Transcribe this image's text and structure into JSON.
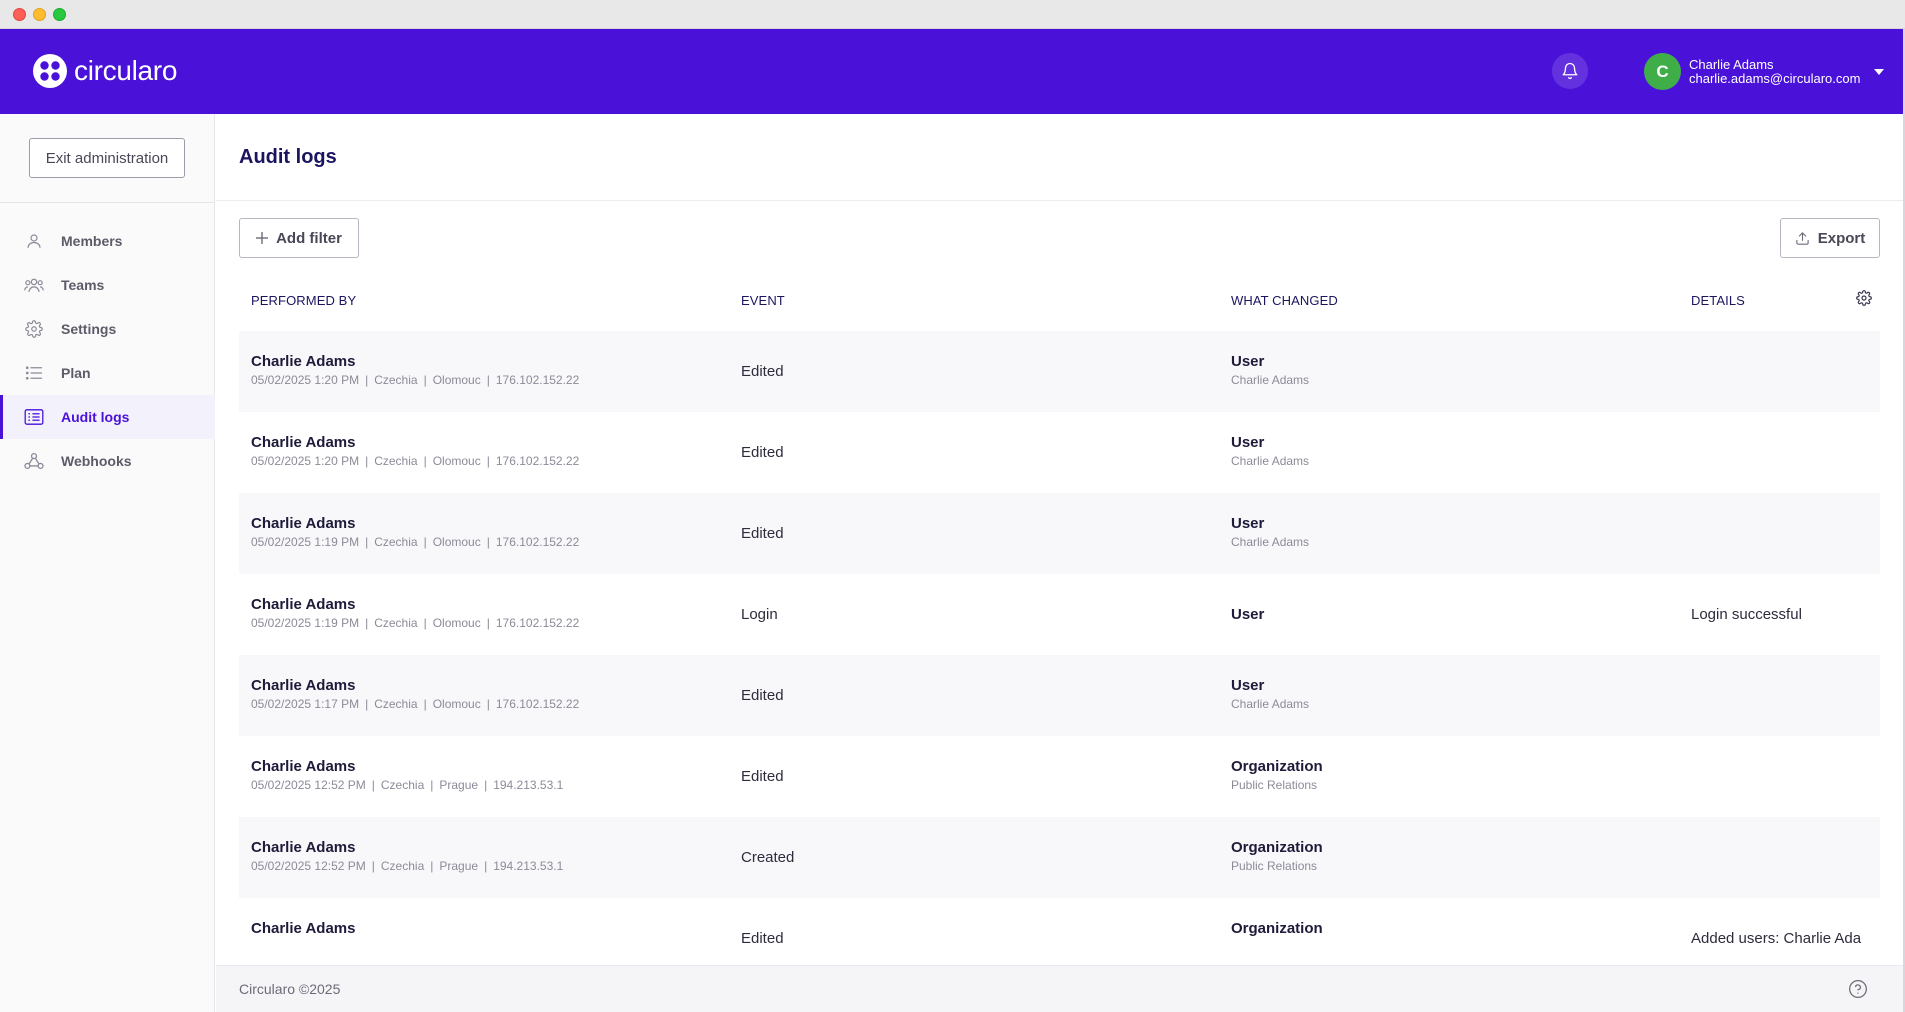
{
  "app": {
    "name": "circularo",
    "brand_color": "#4a11d9"
  },
  "user": {
    "initial": "C",
    "name": "Charlie Adams",
    "email": "charlie.adams@circularo.com",
    "avatar_color": "#3fae49"
  },
  "sidebar": {
    "exit_label": "Exit administration",
    "items": [
      {
        "label": "Members",
        "icon": "person-icon",
        "active": false
      },
      {
        "label": "Teams",
        "icon": "people-icon",
        "active": false
      },
      {
        "label": "Settings",
        "icon": "gear-icon",
        "active": false
      },
      {
        "label": "Plan",
        "icon": "list-icon",
        "active": false
      },
      {
        "label": "Audit logs",
        "icon": "log-icon",
        "active": true
      },
      {
        "label": "Webhooks",
        "icon": "webhook-icon",
        "active": false
      }
    ]
  },
  "main": {
    "title": "Audit logs",
    "add_filter_label": "Add filter",
    "export_label": "Export"
  },
  "table": {
    "headers": {
      "performed_by": "PERFORMED BY",
      "event": "EVENT",
      "what_changed": "WHAT CHANGED",
      "details": "DETAILS"
    },
    "rows": [
      {
        "name": "Charlie Adams",
        "datetime": "05/02/2025 1:20 PM",
        "country": "Czechia",
        "city": "Olomouc",
        "ip": "176.102.152.22",
        "event": "Edited",
        "what": "User",
        "what_sub": "Charlie Adams",
        "details": ""
      },
      {
        "name": "Charlie Adams",
        "datetime": "05/02/2025 1:20 PM",
        "country": "Czechia",
        "city": "Olomouc",
        "ip": "176.102.152.22",
        "event": "Edited",
        "what": "User",
        "what_sub": "Charlie Adams",
        "details": ""
      },
      {
        "name": "Charlie Adams",
        "datetime": "05/02/2025 1:19 PM",
        "country": "Czechia",
        "city": "Olomouc",
        "ip": "176.102.152.22",
        "event": "Edited",
        "what": "User",
        "what_sub": "Charlie Adams",
        "details": ""
      },
      {
        "name": "Charlie Adams",
        "datetime": "05/02/2025 1:19 PM",
        "country": "Czechia",
        "city": "Olomouc",
        "ip": "176.102.152.22",
        "event": "Login",
        "what": "User",
        "what_sub": "",
        "details": "Login successful"
      },
      {
        "name": "Charlie Adams",
        "datetime": "05/02/2025 1:17 PM",
        "country": "Czechia",
        "city": "Olomouc",
        "ip": "176.102.152.22",
        "event": "Edited",
        "what": "User",
        "what_sub": "Charlie Adams",
        "details": ""
      },
      {
        "name": "Charlie Adams",
        "datetime": "05/02/2025 12:52 PM",
        "country": "Czechia",
        "city": "Prague",
        "ip": "194.213.53.1",
        "event": "Edited",
        "what": "Organization",
        "what_sub": "Public Relations",
        "details": ""
      },
      {
        "name": "Charlie Adams",
        "datetime": "05/02/2025 12:52 PM",
        "country": "Czechia",
        "city": "Prague",
        "ip": "194.213.53.1",
        "event": "Created",
        "what": "Organization",
        "what_sub": "Public Relations",
        "details": ""
      },
      {
        "name": "Charlie Adams",
        "datetime": "",
        "country": "",
        "city": "",
        "ip": "",
        "event": "Edited",
        "what": "Organization",
        "what_sub": "",
        "details": "Added users: Charlie Ada"
      }
    ]
  },
  "footer": {
    "copyright": "Circularo ©2025"
  }
}
